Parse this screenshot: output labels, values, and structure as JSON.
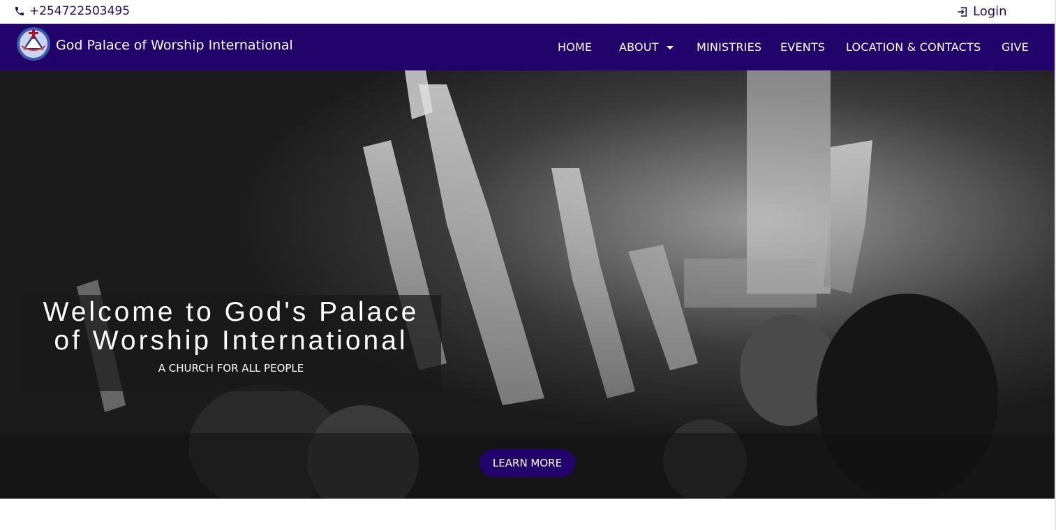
{
  "topbar": {
    "phone": "+254722503495",
    "phone_icon": "phone-icon",
    "login": "Login",
    "login_icon": "login-icon"
  },
  "navbar": {
    "brand": "God Palace of Worship International",
    "logo_icon": "church-logo",
    "items": {
      "home": "HOME",
      "about": "ABOUT",
      "ministries": "MINISTRIES",
      "events": "EVENTS",
      "location": "LOCATION & CONTACTS",
      "give": "GIVE"
    },
    "about_icon": "caret-down-icon"
  },
  "hero": {
    "title_line1": "Welcome to God's Palace",
    "title_line2": "of Worship International",
    "subtitle": "A CHURCH FOR ALL PEOPLE",
    "button": "LEARN MORE"
  },
  "colors": {
    "brand": "#22036b",
    "text_dark": "#22095f",
    "white": "#ffffff"
  }
}
